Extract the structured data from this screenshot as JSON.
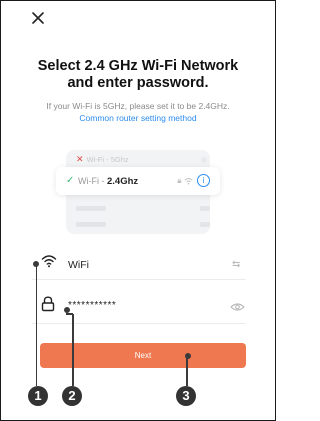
{
  "dialog": {
    "title_line1": "Select 2.4 GHz Wi-Fi Network",
    "title_line2": "and enter password.",
    "subtitle": "If your Wi-Fi is 5GHz, please set it to be 2.4GHz.",
    "help_link": "Common router setting method"
  },
  "illustration": {
    "bad_network": "Wi-Fi - 5Ghz",
    "good_network_prefix": "Wi-Fi - ",
    "good_network_band": "2.4Ghz",
    "bad_status_color": "#e04b4b",
    "good_status_color": "#3cb879"
  },
  "form": {
    "ssid_value": "WiFi",
    "password_value": "***********",
    "next_label": "Next",
    "accent_color": "#f07850"
  },
  "callouts": [
    "1",
    "2",
    "3"
  ]
}
